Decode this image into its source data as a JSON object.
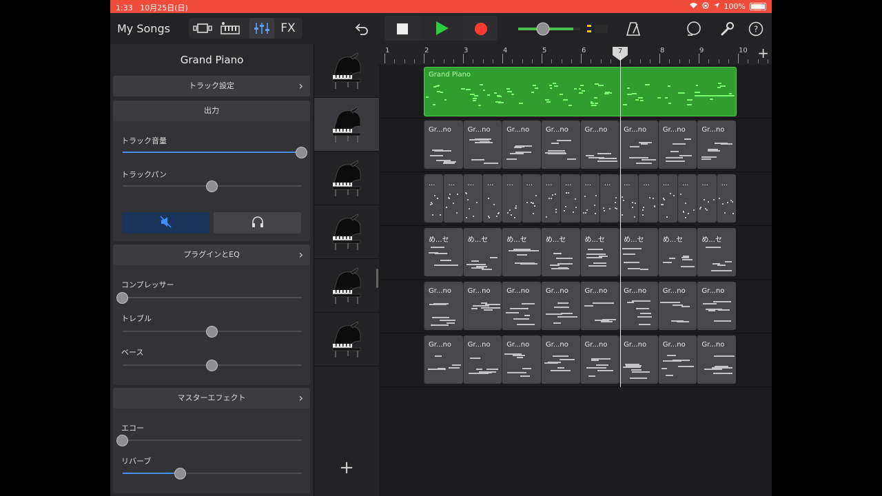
{
  "status_bar": {
    "time": "1:33",
    "date": "10月25日(日)",
    "battery": "100%"
  },
  "toolbar": {
    "my_songs": "My Songs",
    "fx_label": "FX",
    "icons": [
      "browser-icon",
      "keyboard-icon",
      "mixer-icon",
      "undo-icon",
      "stop-icon",
      "play-icon",
      "record-icon",
      "metronome-icon",
      "loop-icon",
      "wrench-icon",
      "help-icon"
    ],
    "colors": {
      "play": "#2ecc40",
      "record": "#ff3b30",
      "lcd": "#7ad96e"
    }
  },
  "inspector": {
    "title": "Grand Piano",
    "track_settings": "トラック設定",
    "output": "出力",
    "track_volume": {
      "label": "トラック音量",
      "value": 1.0
    },
    "track_pan": {
      "label": "トラックパン",
      "value": 0.5
    },
    "plugins_eq": "プラグインとEQ",
    "compressor": {
      "label": "コンプレッサー",
      "value": 0.0
    },
    "treble": {
      "label": "トレブル",
      "value": 0.5
    },
    "bass": {
      "label": "ベース",
      "value": 0.5
    },
    "master_effects": "マスターエフェクト",
    "echo": {
      "label": "エコー",
      "value": 0.0
    },
    "reverb": {
      "label": "リバーブ",
      "value": 0.32
    }
  },
  "ruler": {
    "bars": [
      "1",
      "2",
      "3",
      "4",
      "5",
      "6",
      "7",
      "8",
      "9",
      "10"
    ],
    "playhead_bar": "7"
  },
  "tracks": [
    {
      "regions": [
        {
          "name": "Grand Piano"
        }
      ]
    },
    {
      "regions": [
        {
          "name": "Gr...no"
        },
        {
          "name": "Gr...no"
        },
        {
          "name": "Gr...no"
        },
        {
          "name": "Gr...no"
        },
        {
          "name": "Gr...no"
        },
        {
          "name": "Gr...no"
        },
        {
          "name": "Gr...no"
        },
        {
          "name": "Gr...no"
        }
      ]
    },
    {
      "regions": [
        {
          "name": "..."
        },
        {
          "name": "..."
        },
        {
          "name": "..."
        },
        {
          "name": "..."
        },
        {
          "name": "..."
        },
        {
          "name": "..."
        },
        {
          "name": "..."
        },
        {
          "name": "..."
        },
        {
          "name": "..."
        },
        {
          "name": "..."
        },
        {
          "name": "..."
        },
        {
          "name": "..."
        },
        {
          "name": "..."
        },
        {
          "name": "..."
        },
        {
          "name": "..."
        },
        {
          "name": "..."
        }
      ]
    },
    {
      "regions": [
        {
          "name": "め...セ"
        },
        {
          "name": "め...セ"
        },
        {
          "name": "め...セ"
        },
        {
          "name": "め...セ"
        },
        {
          "name": "め...セ"
        },
        {
          "name": "め...セ"
        },
        {
          "name": "め...セ"
        },
        {
          "name": "め...セ"
        }
      ]
    },
    {
      "regions": [
        {
          "name": "Gr...no"
        },
        {
          "name": "Gr...no"
        },
        {
          "name": "Gr...no"
        },
        {
          "name": "Gr...no"
        },
        {
          "name": "Gr...no"
        },
        {
          "name": "Gr...no"
        },
        {
          "name": "Gr...no"
        },
        {
          "name": "Gr...no"
        }
      ]
    },
    {
      "regions": [
        {
          "name": "Gr...no"
        },
        {
          "name": "Gr...no"
        },
        {
          "name": "Gr...no"
        },
        {
          "name": "Gr...no"
        },
        {
          "name": "Gr...no"
        },
        {
          "name": "Gr...no"
        },
        {
          "name": "Gr...no"
        },
        {
          "name": "Gr...no"
        }
      ]
    }
  ],
  "add_track": "+"
}
